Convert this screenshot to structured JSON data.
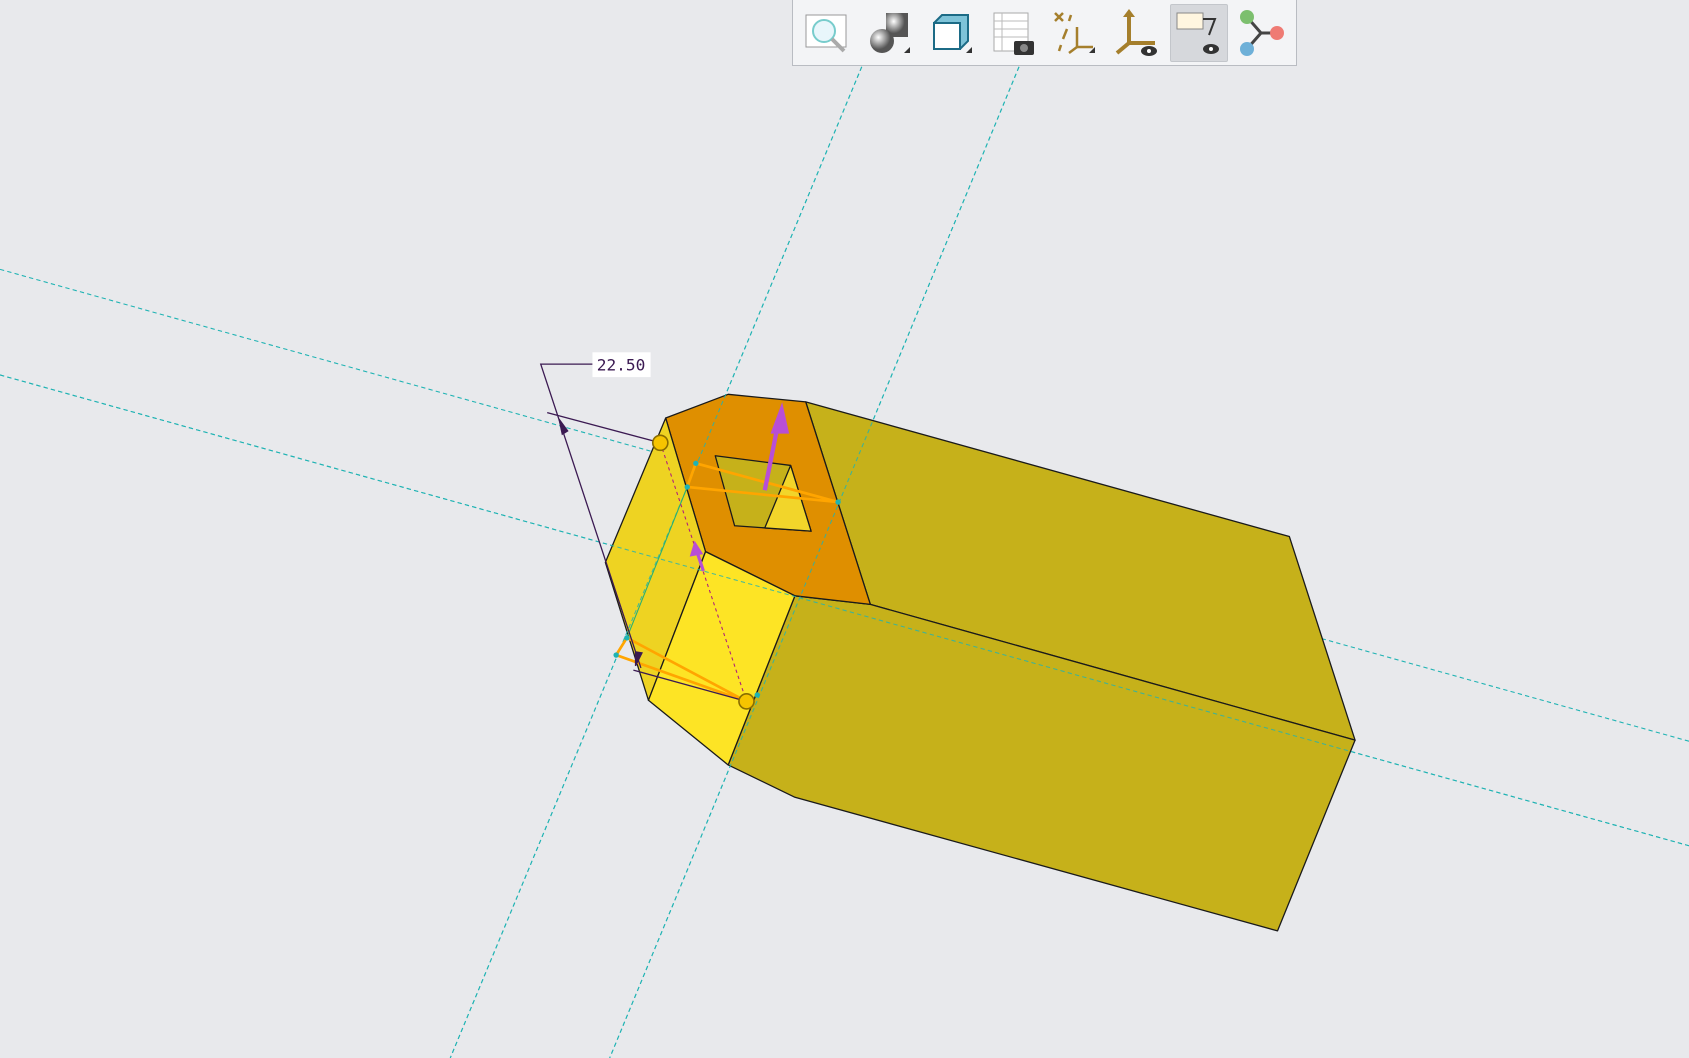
{
  "toolbar": {
    "buttons": [
      {
        "icon": "zoom-to-fit-icon",
        "active": false
      },
      {
        "icon": "display-style-icon",
        "active": false
      },
      {
        "icon": "saved-views-cube-icon",
        "active": false
      },
      {
        "icon": "view-manager-snapshot-icon",
        "active": false
      },
      {
        "icon": "datum-display-filters-icon",
        "active": false
      },
      {
        "icon": "coordinate-system-display-icon",
        "active": false
      },
      {
        "icon": "annotation-display-icon",
        "active": true
      },
      {
        "icon": "spin-center-icon",
        "active": false
      }
    ]
  },
  "model": {
    "dimension_value": "22.50",
    "colors": {
      "background": "#e8e9ec",
      "body": "#c6b11a",
      "selected_face": "#df8f00",
      "highlight_face": "#f2d52a",
      "bright_face": "#fde425",
      "datum_plane": "#1fb3b3",
      "dimension": "#3b1a52",
      "direction_arrow": "#b84fd6",
      "preview_edge": "#ffa500"
    }
  }
}
